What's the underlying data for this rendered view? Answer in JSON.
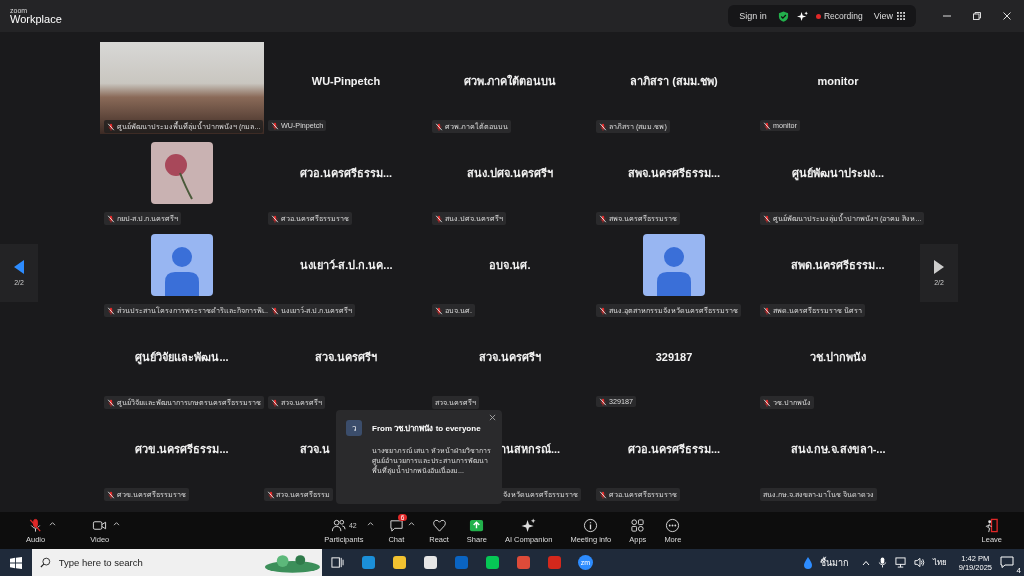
{
  "titlebar": {
    "brand_small": "zoom",
    "brand": "Workplace",
    "sign_in": "Sign in",
    "recording": "Recording",
    "view": "View"
  },
  "pager": {
    "left": "2/2",
    "right": "2/2"
  },
  "tiles": [
    {
      "kind": "video",
      "label": "ศูนย์พัฒนาประมงพื้นที่ลุ่มน้ำปากพนังฯ (กมล...",
      "muted": true
    },
    {
      "kind": "name",
      "name": "WU-Pinpetch",
      "label": "WU-Pinpetch",
      "muted": true
    },
    {
      "kind": "name",
      "name": "ศวพ.ภาคใต้ตอนบน",
      "label": "ศวพ.ภาคใต้ตอนบน",
      "muted": true
    },
    {
      "kind": "name",
      "name": "ลาภิสรา (สมม.ชพ)",
      "label": "ลาภิสรา (สมม.ชพ)",
      "muted": true
    },
    {
      "kind": "name",
      "name": "monitor",
      "label": "monitor",
      "muted": true
    },
    {
      "kind": "image",
      "label": "กยป-ส.ป.ก.นครศรีฯ",
      "muted": true
    },
    {
      "kind": "name",
      "name": "ศวอ.นครศรีธรรม...",
      "label": "ศวอ.นครศรีธรรมราช",
      "muted": true
    },
    {
      "kind": "name",
      "name": "สนง.ปศจ.นครศรีฯ",
      "label": "สนง.ปศจ.นครศรีฯ",
      "muted": true
    },
    {
      "kind": "name",
      "name": "สพจ.นครศรีธรรม...",
      "label": "สพจ.นครศรีธรรมราช",
      "muted": true
    },
    {
      "kind": "name",
      "name": "ศูนย์พัฒนาประมง...",
      "label": "ศูนย์พัฒนาประมงลุ่มน้ำปากพนังฯ (อาคม สิงห...",
      "muted": true
    },
    {
      "kind": "avatar",
      "label": "ส่วนประสานโครงการพระราชดำริและกิจการพิเ...",
      "muted": true
    },
    {
      "kind": "name",
      "name": "นงเยาว์-ส.ป.ก.นค...",
      "label": "นงเยาว์-ส.ป.ก.นครศรีฯ",
      "muted": true
    },
    {
      "kind": "name",
      "name": "อบจ.นศ.",
      "label": "อบจ.นศ.",
      "muted": true
    },
    {
      "kind": "avatar",
      "label": "สนง.อุตสาหกรรมจังหวัดนครศรีธรรมราช",
      "muted": true
    },
    {
      "kind": "name",
      "name": "สพด.นครศรีธรรม...",
      "label": "สพด.นครศรีธรรมราช นิศรา",
      "muted": true
    },
    {
      "kind": "name",
      "name": "ศูนย์วิจัยและพัฒน...",
      "label": "ศูนย์วิจัยและพัฒนาการเกษตรนครศรีธรรมราช",
      "muted": true
    },
    {
      "kind": "name",
      "name": "สวจ.นครศรีฯ",
      "label": "สวจ.นครศรีฯ",
      "muted": true
    },
    {
      "kind": "name",
      "name": "สวจ.นครศรีฯ",
      "label": "สวจ.นครศรีฯ",
      "muted": false
    },
    {
      "kind": "name",
      "name": "329187",
      "label": "329187",
      "muted": true
    },
    {
      "kind": "name",
      "name": "วช.ปากพนัง",
      "label": "วช.ปากพนัง",
      "muted": true
    },
    {
      "kind": "name",
      "name": "ศวข.นครศรีธรรม...",
      "label": "ศวข.นครศรีธรรมราช",
      "muted": true
    },
    {
      "kind": "name",
      "name": "สวจ.น",
      "label": "สวจ.นครศรีธรรม",
      "muted": true,
      "covered_right": true
    },
    {
      "kind": "name",
      "name": "านสหกรณ์...",
      "label": "จังหวัดนครศรีธรรมราช",
      "muted": false,
      "covered_left": true
    },
    {
      "kind": "name",
      "name": "ศวอ.นครศรีธรรม...",
      "label": "ศวอ.นครศรีธรรมราช",
      "muted": true
    },
    {
      "kind": "name",
      "name": "สนง.กษ.จ.สงขลา-...",
      "label": "สนง.กษ.จ.สงขลา-มาโนช จินดาดวง",
      "muted": false
    }
  ],
  "chat_popup": {
    "avatar": "ว",
    "title": "From วช.ปากพนัง to everyone",
    "message": "นางชยาภรณ์  เสนา หัวหน้าฝ่ายวิชาการ ศูนย์อำนวยการและประสานการพัฒนาพื้นที่ลุ่มน้ำปากพนังอันเนื่องม..."
  },
  "toolbar": [
    {
      "kind": "audio",
      "label": "Audio",
      "muted": true,
      "caret": true
    },
    {
      "kind": "video",
      "label": "Video",
      "caret": true
    },
    {
      "kind": "participants",
      "label": "Participants",
      "count": "42",
      "caret": true
    },
    {
      "kind": "chat",
      "label": "Chat",
      "badge": "6",
      "caret": true
    },
    {
      "kind": "react",
      "label": "React"
    },
    {
      "kind": "share",
      "label": "Share"
    },
    {
      "kind": "ai",
      "label": "AI Companion"
    },
    {
      "kind": "info",
      "label": "Meeting info"
    },
    {
      "kind": "apps",
      "label": "Apps"
    },
    {
      "kind": "more",
      "label": "More"
    },
    {
      "kind": "leave",
      "label": "Leave"
    }
  ],
  "taskbar": {
    "search": {
      "placeholder": "Type here to search"
    },
    "apps": [
      {
        "kind": "taskview"
      },
      {
        "kind": "edge"
      },
      {
        "kind": "explorer"
      },
      {
        "kind": "store"
      },
      {
        "kind": "outlook"
      },
      {
        "kind": "line"
      },
      {
        "kind": "chrome"
      },
      {
        "kind": "pdf"
      },
      {
        "kind": "zoom",
        "label": "zm"
      }
    ],
    "weather": "ชื้นมาก",
    "language": "ไทย",
    "time": "1:42 PM",
    "date": "9/19/2025",
    "notifications": "4"
  }
}
